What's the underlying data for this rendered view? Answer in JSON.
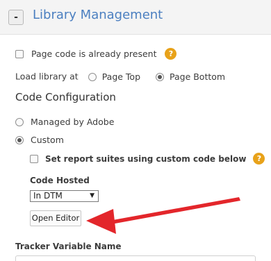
{
  "header": {
    "collapse_label": "-",
    "title": "Library Management"
  },
  "library": {
    "page_code_present_label": "Page code is already present",
    "page_code_present_checked": false,
    "load_library_at_label": "Load library at",
    "load_options": [
      {
        "label": "Page Top",
        "selected": false
      },
      {
        "label": "Page Bottom",
        "selected": true
      }
    ],
    "help_glyph": "?"
  },
  "code_configuration": {
    "title": "Code Configuration",
    "options": [
      {
        "label": "Managed by Adobe",
        "selected": false
      },
      {
        "label": "Custom",
        "selected": true
      }
    ],
    "custom_report_suites_label": "Set report suites using custom code below",
    "custom_report_suites_checked": false,
    "code_hosted_label": "Code Hosted",
    "code_hosted_value": "In DTM",
    "open_editor_label": "Open Editor",
    "tracker_variable_name_label": "Tracker Variable Name"
  },
  "icons": {
    "help": "question-help-icon",
    "annotation": "red-arrow-annotation"
  },
  "colors": {
    "title_blue": "#4b7fc0",
    "help_orange": "#e8a21a",
    "arrow_red": "#e3262b"
  }
}
